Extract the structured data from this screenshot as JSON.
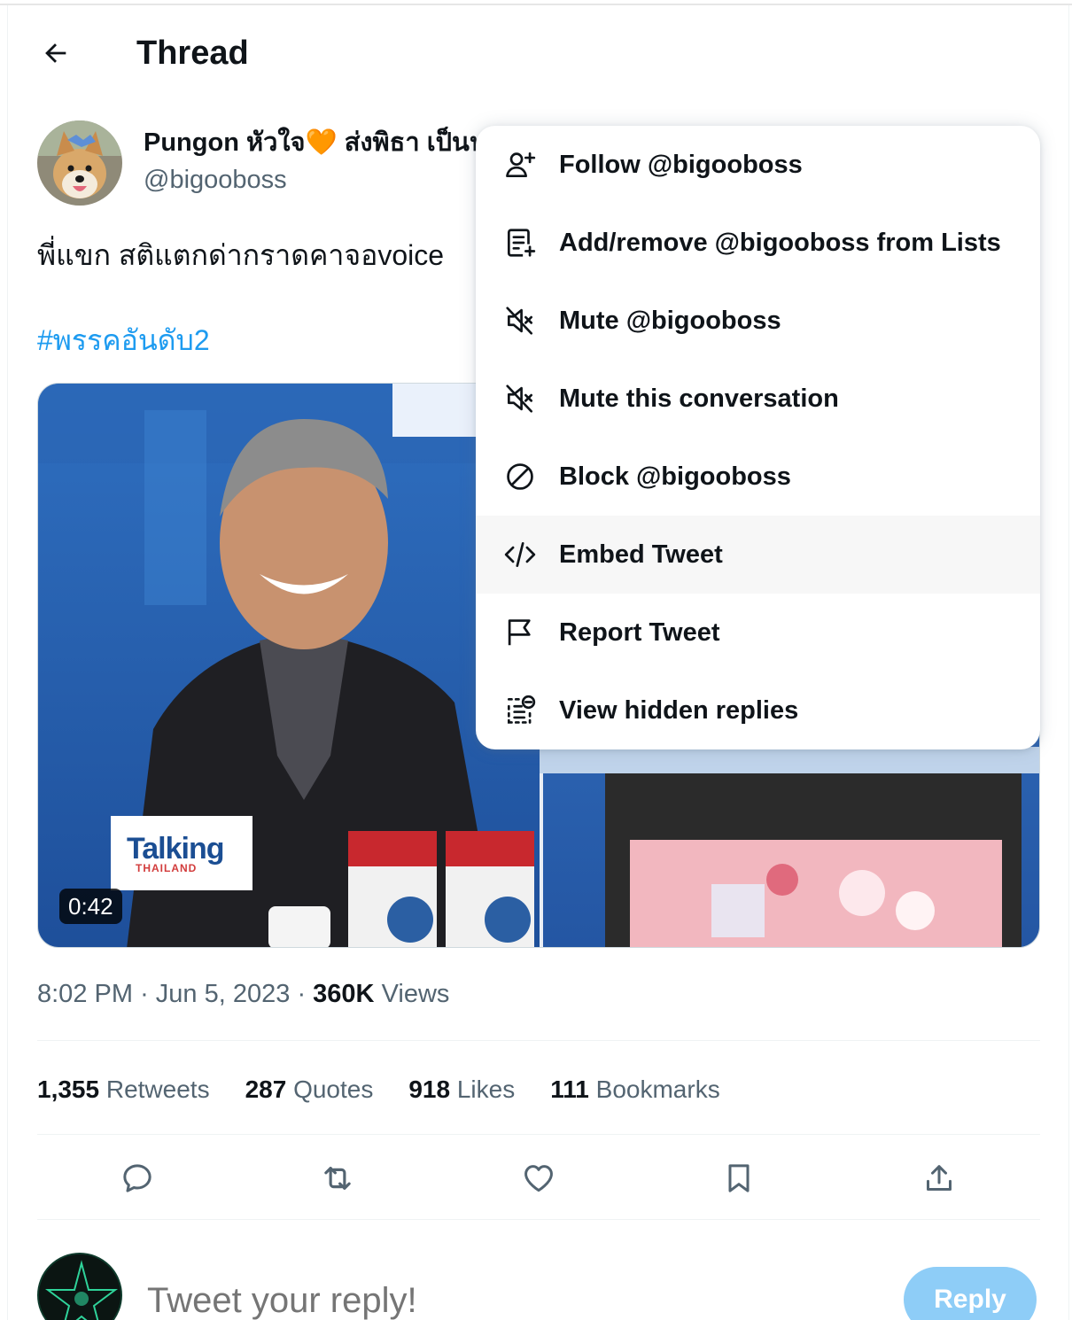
{
  "header": {
    "title": "Thread"
  },
  "tweet": {
    "display_name": "Pungon หัวใจ🧡 ส่งพิธา เป็นนายกฯ",
    "handle": "@bigooboss",
    "text": "พี่แขก สติแตกด่ากราดคาจอvoice",
    "hashtag": "#พรรคอันดับ2",
    "media": {
      "duration": "0:42",
      "overlay_logo": "Talking",
      "overlay_logo_sub": "THAILAND"
    },
    "time": "8:02 PM",
    "date": "Jun 5, 2023",
    "views_count": "360K",
    "views_label": "Views",
    "separator": "·"
  },
  "stats": {
    "retweets": {
      "count": "1,355",
      "label": "Retweets"
    },
    "quotes": {
      "count": "287",
      "label": "Quotes"
    },
    "likes": {
      "count": "918",
      "label": "Likes"
    },
    "bookmarks": {
      "count": "111",
      "label": "Bookmarks"
    }
  },
  "reply_box": {
    "placeholder": "Tweet your reply!",
    "button_label": "Reply"
  },
  "menu": {
    "items": [
      {
        "label": "Follow @bigooboss",
        "icon": "follow-user-icon"
      },
      {
        "label": "Add/remove @bigooboss from Lists",
        "icon": "list-add-icon"
      },
      {
        "label": "Mute @bigooboss",
        "icon": "mute-icon"
      },
      {
        "label": "Mute this conversation",
        "icon": "mute-conversation-icon"
      },
      {
        "label": "Block @bigooboss",
        "icon": "block-icon"
      },
      {
        "label": "Embed Tweet",
        "icon": "embed-code-icon"
      },
      {
        "label": "Report Tweet",
        "icon": "flag-icon"
      },
      {
        "label": "View hidden replies",
        "icon": "hidden-replies-icon"
      }
    ],
    "highlighted_index": 5
  },
  "colors": {
    "accent": "#1d9bf0",
    "text_primary": "#0f1419",
    "text_secondary": "#536471",
    "reply_button": "#8ecdf7"
  }
}
